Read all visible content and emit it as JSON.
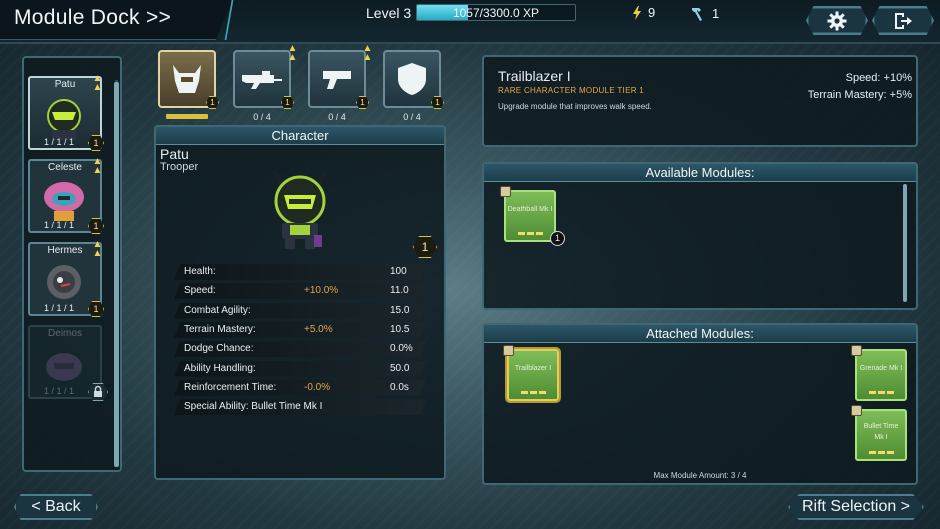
{
  "header": {
    "title": "Module Dock >>",
    "level": "Level 3",
    "xp_text": "1057/3300.0 XP",
    "xp_progress": 0.32,
    "energy": "9",
    "tools": "1"
  },
  "characters": [
    {
      "name": "Patu",
      "count": "1 / 1 / 1",
      "badge": "1",
      "upgrade": true,
      "selected": true,
      "locked": false
    },
    {
      "name": "Celeste",
      "count": "1 / 1 / 1",
      "badge": "1",
      "upgrade": true,
      "selected": false,
      "locked": false
    },
    {
      "name": "Hermes",
      "count": "1 / 1 / 1",
      "badge": "1",
      "upgrade": true,
      "selected": false,
      "locked": false
    },
    {
      "name": "Deimos",
      "count": "1 / 1 / 1",
      "badge": "",
      "upgrade": false,
      "selected": false,
      "locked": true
    }
  ],
  "slots": [
    {
      "icon": "helmet-icon",
      "count": "",
      "badge": "1",
      "selected": true,
      "upgrade": false
    },
    {
      "icon": "rifle-icon",
      "count": "0 / 4",
      "badge": "1",
      "selected": false,
      "upgrade": true
    },
    {
      "icon": "pistol-icon",
      "count": "0 / 4",
      "badge": "1",
      "selected": false,
      "upgrade": true
    },
    {
      "icon": "shield-icon",
      "count": "0 / 4",
      "badge": "1",
      "selected": false,
      "upgrade": false
    }
  ],
  "character_panel": {
    "header": "Character",
    "name": "Patu",
    "class": "Trooper",
    "level_badge": "1",
    "stats": [
      {
        "label": "Health:",
        "mod": "",
        "value": "100"
      },
      {
        "label": "Speed:",
        "mod": "+10.0%",
        "value": "11.0"
      },
      {
        "label": "Combat Agility:",
        "mod": "",
        "value": "15.0"
      },
      {
        "label": "Terrain Mastery:",
        "mod": "+5.0%",
        "value": "10.5"
      },
      {
        "label": "Dodge Chance:",
        "mod": "",
        "value": "0.0%"
      },
      {
        "label": "Ability Handling:",
        "mod": "",
        "value": "50.0"
      },
      {
        "label": "Reinforcement Time:",
        "mod": "-0.0%",
        "value": "0.0s"
      },
      {
        "label": "Special Ability: Bullet Time Mk I",
        "mod": "",
        "value": ""
      }
    ]
  },
  "module_info": {
    "name": "Trailblazer I",
    "subtitle": "RARE CHARACTER MODULE TIER 1",
    "description": "Upgrade module that improves walk speed.",
    "stat1_label": "Speed:",
    "stat1_value": "+10%",
    "stat2_label": "Terrain Mastery:",
    "stat2_value": "+5%"
  },
  "available": {
    "header": "Available Modules:",
    "modules": [
      {
        "name": "Deathball Mk I",
        "badge": "1"
      }
    ]
  },
  "attached": {
    "header": "Attached Modules:",
    "modules": [
      {
        "name": "Trailblazer I"
      },
      {
        "name": "Grenade Mk I"
      },
      {
        "name": "Bullet Time Mk I"
      }
    ],
    "footer": "Max Module Amount: 3 / 4"
  },
  "buttons": {
    "back": "< Back",
    "rift": "Rift Selection >"
  },
  "colors": {
    "accent": "#4fc4dc",
    "gold": "#d8bf3c",
    "module_green": "#6fae4a"
  }
}
